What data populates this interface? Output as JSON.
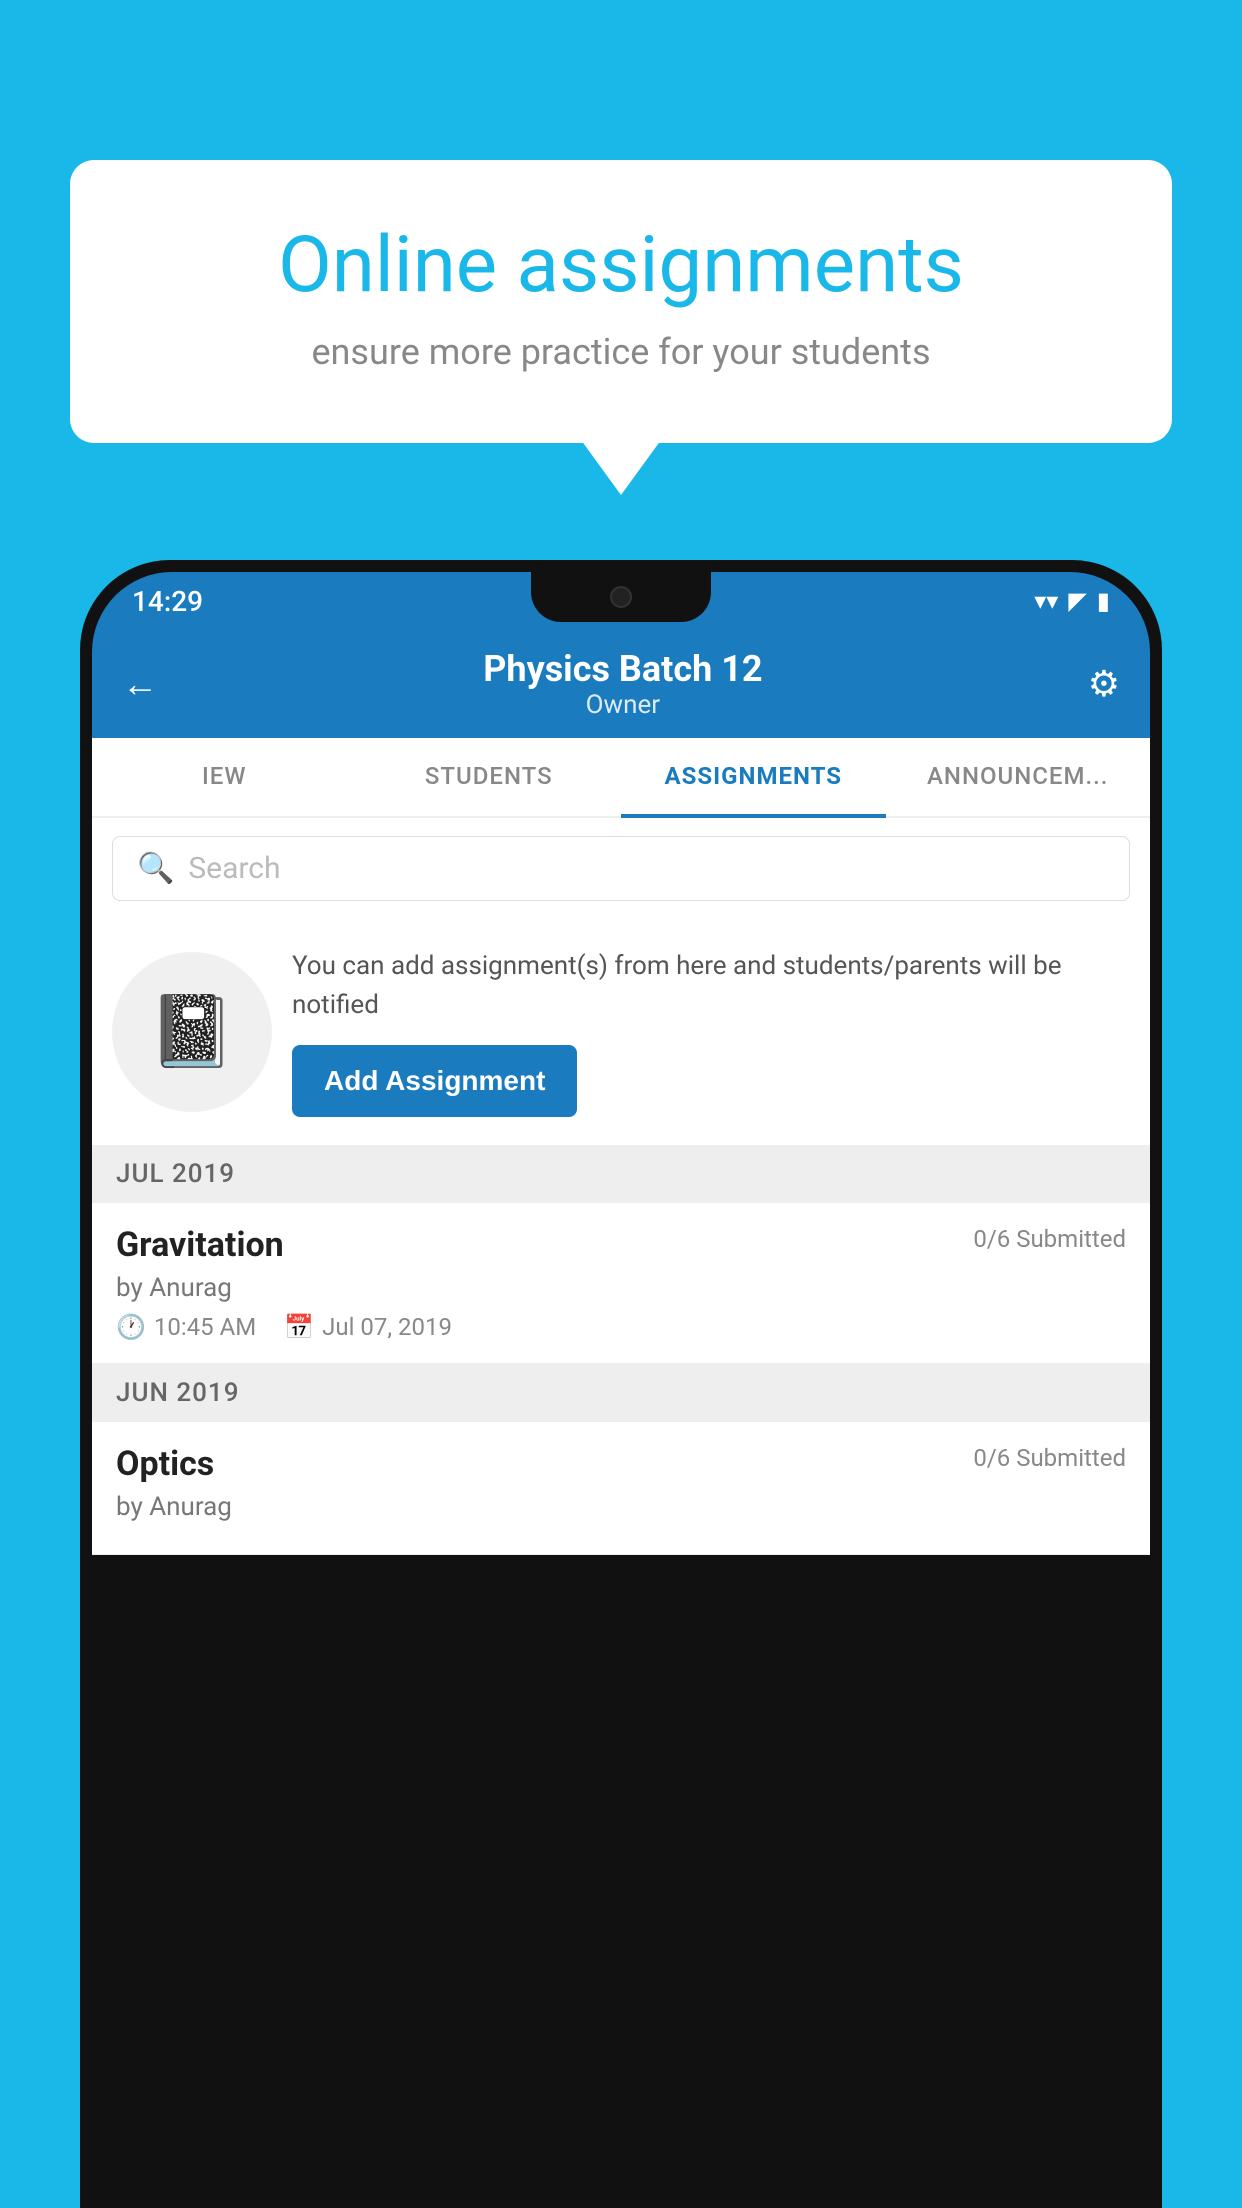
{
  "background_color": "#1ab8e8",
  "speech_bubble": {
    "title": "Online assignments",
    "subtitle": "ensure more practice for your students"
  },
  "phone": {
    "status_bar": {
      "time": "14:29",
      "wifi": "▼",
      "signal": "▲",
      "battery": "■"
    },
    "header": {
      "title": "Physics Batch 12",
      "subtitle": "Owner",
      "back_label": "←",
      "gear_label": "⚙"
    },
    "tabs": [
      {
        "label": "IEW",
        "active": false
      },
      {
        "label": "STUDENTS",
        "active": false
      },
      {
        "label": "ASSIGNMENTS",
        "active": true
      },
      {
        "label": "ANNOUNCEM...",
        "active": false
      }
    ],
    "search": {
      "placeholder": "Search"
    },
    "promo": {
      "description": "You can add assignment(s) from here and students/parents will be notified",
      "button_label": "Add Assignment"
    },
    "sections": [
      {
        "header": "JUL 2019",
        "assignments": [
          {
            "name": "Gravitation",
            "submitted": "0/6 Submitted",
            "by": "by Anurag",
            "time": "10:45 AM",
            "date": "Jul 07, 2019"
          }
        ]
      },
      {
        "header": "JUN 2019",
        "assignments": [
          {
            "name": "Optics",
            "submitted": "0/6 Submitted",
            "by": "by Anurag",
            "time": "",
            "date": ""
          }
        ]
      }
    ]
  }
}
